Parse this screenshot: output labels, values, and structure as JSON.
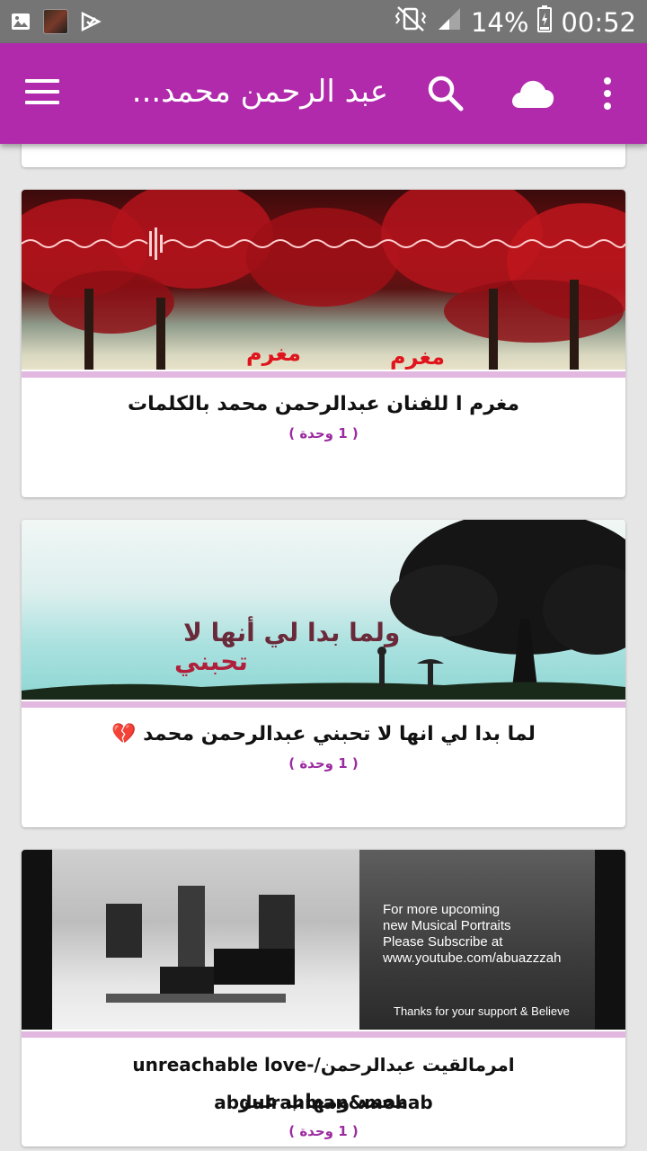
{
  "status_bar": {
    "battery": "14%",
    "time": "00:52"
  },
  "app_bar": {
    "title": "عبد الرحمن محمد...",
    "menu_icon": "hamburger-icon",
    "search_icon": "search-icon",
    "cloud_icon": "cloud-icon",
    "more_icon": "more-vert-icon",
    "color": "#b02aab"
  },
  "videos": [
    {
      "title": "مغرم ا للفنان عبدالرحمن محمد بالكلمات",
      "count": "( 1 وحدة )",
      "thumb_text": "مغرم"
    },
    {
      "title": "لما بدا لي انها لا تحبني عبدالرحمن محمد 💔",
      "count": "( 1 وحدة )",
      "thumb_line1": "ولما بدا لي أنها لا",
      "thumb_line2": "تحبني"
    },
    {
      "title_line1": "امرمالقيت عبدالرحمن/unreachable love-abdulrahman&mohab",
      "title_line2": "محمد ومهاب عمر",
      "count": "( 1 وحدة )",
      "thumb_lines": [
        "For more upcoming",
        "new Musical Portraits",
        "Please Subscribe at",
        "www.youtube.com/abuazzzah"
      ],
      "thumb_footer": "Thanks for your support & Believe"
    }
  ],
  "colors": {
    "accent_bar": "#e2b8e0",
    "count_text": "#9b2ba0"
  }
}
